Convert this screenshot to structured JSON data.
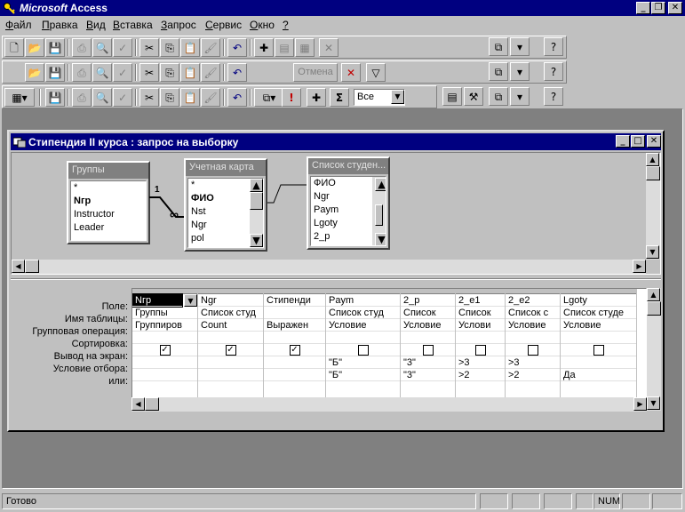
{
  "app": {
    "title_prefix": "Microsoft",
    "title_suffix": "Access"
  },
  "menu": [
    {
      "label": "Файл",
      "u": "Ф",
      "rest": "айл"
    },
    {
      "label": "Правка",
      "u": "П",
      "rest": "равка"
    },
    {
      "label": "Вид",
      "u": "В",
      "rest": "ид"
    },
    {
      "label": "Вставка",
      "u": "В",
      "rest": "ставка"
    },
    {
      "label": "Запрос",
      "u": "З",
      "rest": "апрос"
    },
    {
      "label": "Сервис",
      "u": "С",
      "rest": "ервис"
    },
    {
      "label": "Окно",
      "u": "О",
      "rest": "кно"
    },
    {
      "label": "?",
      "u": "?",
      "rest": ""
    }
  ],
  "toolbar3": {
    "cancel_label": "Отмена",
    "sigma": "Σ",
    "top_values": "Все"
  },
  "query_window": {
    "title": "Стипендия II курса : запрос на выборку"
  },
  "tables": [
    {
      "name": "Группы",
      "fields": [
        "*",
        "Nгр",
        "Instructor",
        "Leader"
      ],
      "bold": [
        1
      ]
    },
    {
      "name": "Учетная карта",
      "fields": [
        "*",
        "ФИО",
        "Nst",
        "Ngr",
        "pol"
      ],
      "bold": [
        1
      ]
    },
    {
      "name": "Список студен...",
      "fields": [
        "ФИО",
        "Ngr",
        "Paym",
        "Lgoty",
        "2_р"
      ],
      "bold": []
    }
  ],
  "relation_labels": {
    "one": "1",
    "many": "∞"
  },
  "grid": {
    "row_labels": [
      "Поле:",
      "Имя таблицы:",
      "Групповая операция:",
      "Сортировка:",
      "Вывод на экран:",
      "Условие отбора:",
      "или:"
    ],
    "columns": [
      {
        "field": "Nгр",
        "table": "Группы",
        "group": "Группиров",
        "sort": "",
        "show": true,
        "crit": "",
        "or": ""
      },
      {
        "field": "Ngr",
        "table": "Список студ",
        "group": "Count",
        "sort": "",
        "show": true,
        "crit": "",
        "or": ""
      },
      {
        "field": "Стипенди",
        "table": "",
        "group": "Выражен",
        "sort": "",
        "show": true,
        "crit": "",
        "or": ""
      },
      {
        "field": "Paym",
        "table": "Список студ",
        "group": "Условие",
        "sort": "",
        "show": false,
        "crit": "\"Б\"",
        "or": "\"Б\""
      },
      {
        "field": "2_р",
        "table": "Список",
        "group": "Условие",
        "sort": "",
        "show": false,
        "crit": "\"3\"",
        "or": "\"3\""
      },
      {
        "field": "2_e1",
        "table": "Список",
        "group": "Услови",
        "sort": "",
        "show": false,
        "crit": ">3",
        "or": ">2"
      },
      {
        "field": "2_e2",
        "table": "Список с",
        "group": "Условие",
        "sort": "",
        "show": false,
        "crit": ">3",
        "or": ">2"
      },
      {
        "field": "Lgoty",
        "table": "Список студе",
        "group": "Условие",
        "sort": "",
        "show": false,
        "crit": "",
        "or": "Да"
      }
    ]
  },
  "status": {
    "text": "Готово",
    "num": "NUM"
  }
}
